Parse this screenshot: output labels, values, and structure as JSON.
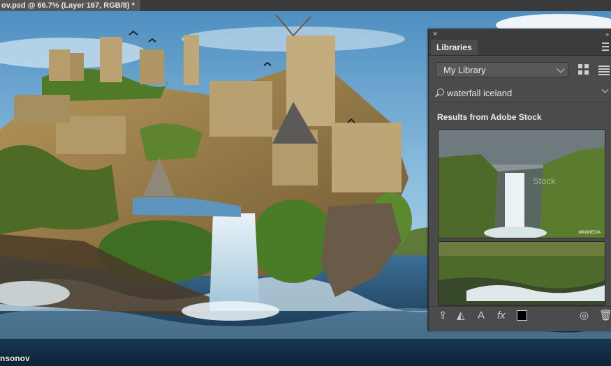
{
  "document": {
    "tab_title": "ov.psd @ 66.7% (Layer 167, RGB/8) *"
  },
  "canvas": {
    "credit_text": "nsonov"
  },
  "libraries_panel": {
    "close_glyph": "×",
    "collapse_glyph": "»",
    "tab_label": "Libraries",
    "library_select": {
      "value": "My Library"
    },
    "search": {
      "value": "waterfall iceland"
    },
    "results_title": "Results from Adobe Stock",
    "results": [
      {
        "watermark": "Stock",
        "badge": "MINIMEDIA"
      },
      {}
    ],
    "footer_icons": [
      "upload-icon",
      "add-graphic-icon",
      "add-character-style-icon",
      "add-layer-style-icon",
      "add-foreground-color-icon",
      "sync-icon",
      "delete-icon"
    ],
    "footer_text": {
      "character": "A",
      "fx": "fx"
    }
  }
}
